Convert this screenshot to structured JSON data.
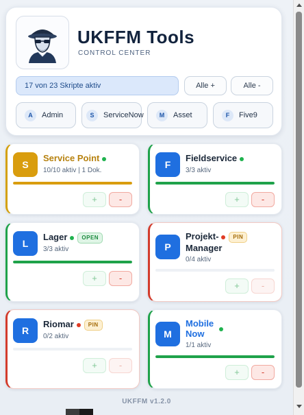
{
  "header": {
    "title": "UKFFM Tools",
    "subtitle": "CONTROL CENTER",
    "status": "17 von 23 Skripte aktiv",
    "all_on": "Alle +",
    "all_off": "Alle -"
  },
  "quick": [
    {
      "letter": "A",
      "label": "Admin"
    },
    {
      "letter": "S",
      "label": "ServiceNow"
    },
    {
      "letter": "M",
      "label": "Asset"
    },
    {
      "letter": "F",
      "label": "Five9"
    }
  ],
  "modules": [
    {
      "letter": "S",
      "name": "Service Point",
      "status": "10/10 aktiv | 1 Dok.",
      "progress": 1.0,
      "tag": ""
    },
    {
      "letter": "F",
      "name": "Fieldservice",
      "status": "3/3 aktiv",
      "progress": 1.0,
      "tag": ""
    },
    {
      "letter": "L",
      "name": "Lager",
      "status": "3/3 aktiv",
      "progress": 1.0,
      "tag": "OPEN"
    },
    {
      "letter": "P",
      "name": "Projekt-\nManager",
      "name_line1": "Projekt-",
      "name_line2": "Manager",
      "status": "0/4 aktiv",
      "progress": 0.0,
      "tag": "PIN"
    },
    {
      "letter": "R",
      "name": "Riomar",
      "status": "0/2 aktiv",
      "progress": 0.0,
      "tag": "PIN"
    },
    {
      "letter": "M",
      "name": "Mobile Now",
      "name_line1": "Mobile",
      "name_line2": "Now",
      "status": "1/1 aktiv",
      "progress": 1.0,
      "tag": ""
    }
  ],
  "buttons": {
    "plus": "+",
    "minus": "-"
  },
  "footer": "UKFFM v1.2.0",
  "colors": {
    "accent_blue": "#1f6fe0",
    "accent_yellow": "#d99d0e",
    "active_green": "#1fa24a",
    "inactive_red": "#d33b2b"
  }
}
